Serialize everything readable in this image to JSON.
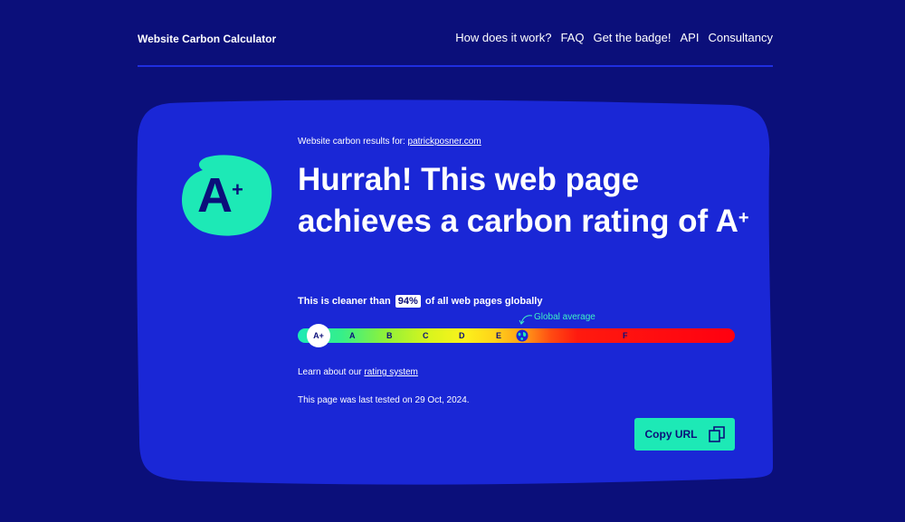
{
  "header": {
    "brand": "Website Carbon Calculator",
    "nav": [
      "How does it work?",
      "FAQ",
      "Get the badge!",
      "API",
      "Consultancy"
    ]
  },
  "result": {
    "grade": "A",
    "grade_sup": "+",
    "results_for_label": "Website carbon results for:",
    "url": "patrickposner.com",
    "headline_main": "Hurrah! This web page achieves a carbon rating of A",
    "headline_sup": "+",
    "cleaner_prefix": "This is cleaner than",
    "cleaner_percent": "94%",
    "cleaner_suffix": "of all web pages globally"
  },
  "scale": {
    "marker_label": "A+",
    "labels": [
      "A",
      "B",
      "C",
      "D",
      "E",
      "F"
    ],
    "global_average_label": "Global average"
  },
  "footer_text": {
    "learn_prefix": "Learn about our",
    "learn_link": "rating system",
    "last_tested": "This page was last tested on 29 Oct, 2024."
  },
  "actions": {
    "copy_label": "Copy URL"
  },
  "colors": {
    "background": "#0b0f7a",
    "card": "#1a27d6",
    "accent": "#1de9b6"
  },
  "icons": {
    "copy": "copy-icon",
    "globe": "globe-icon",
    "arrow": "curved-arrow-icon"
  }
}
